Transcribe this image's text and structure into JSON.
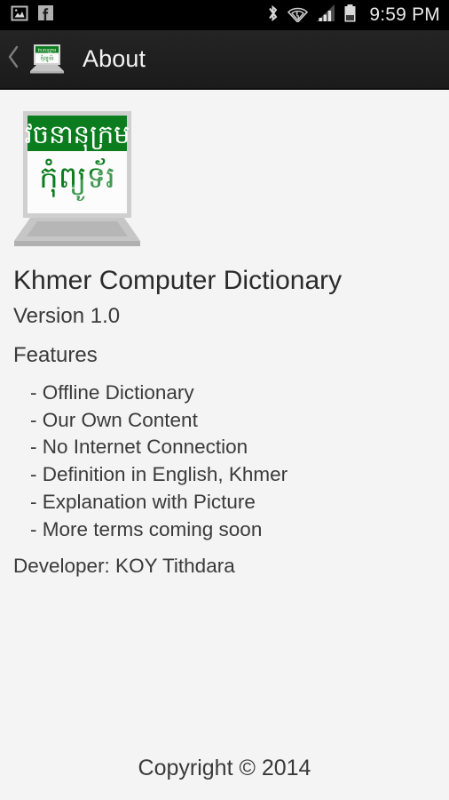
{
  "status_bar": {
    "icons_left": [
      "gallery-image-icon",
      "facebook-icon"
    ],
    "icons_right": [
      "bluetooth-icon",
      "wifi-icon",
      "cellular-signal-icon",
      "battery-icon"
    ],
    "clock": "9:59 PM"
  },
  "action_bar": {
    "back_icon": "back-chevron-icon",
    "app_icon": "app-logo-icon",
    "title": "About"
  },
  "logo": {
    "name": "khmer-computer-dictionary-logo",
    "banner_text": "វចនានុក្រម",
    "screen_text": "កុំព្យូទ័រ",
    "green": "#0b7d1e",
    "bezel": "#c9c9c9",
    "screen_bg": "#fbfbfb",
    "base": "#bdbdbd"
  },
  "about": {
    "app_title": "Khmer Computer Dictionary",
    "version": "Version 1.0",
    "features_heading": "Features",
    "features": [
      "- Offline Dictionary",
      "- Our Own Content",
      "- No Internet Connection",
      "- Definition in English, Khmer",
      "- Explanation with Picture",
      "- More terms coming soon"
    ],
    "developer": "Developer: KOY Tithdara"
  },
  "footer": {
    "copyright": "Copyright © 2014"
  },
  "colors": {
    "page_bg": "#f4f4f4",
    "action_bar_bg": "#1f1f1f",
    "status_bar_bg": "#000000",
    "text": "#3a3a3a",
    "title_text": "#2b2b2b",
    "accent_green": "#0b7d1e"
  }
}
